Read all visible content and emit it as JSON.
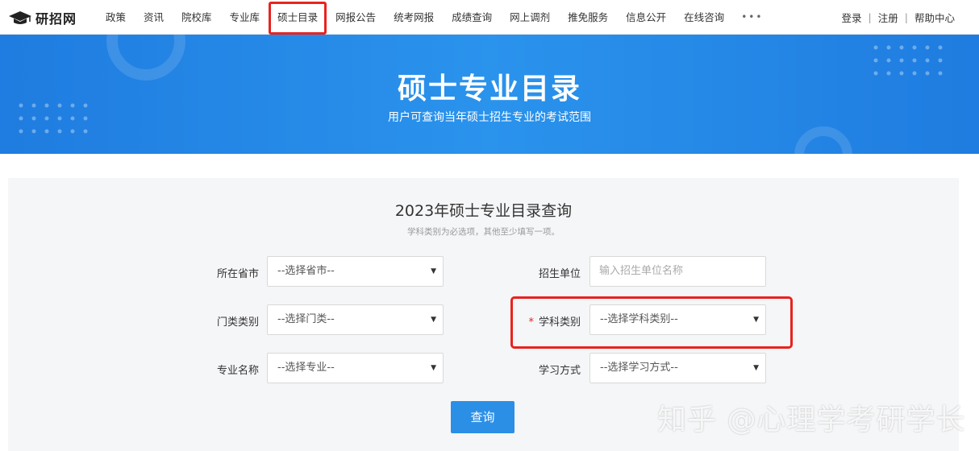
{
  "nav": {
    "logo_text": "研招网",
    "items": [
      "政策",
      "资讯",
      "院校库",
      "专业库",
      "硕士目录",
      "网报公告",
      "统考网报",
      "成绩查询",
      "网上调剂",
      "推免服务",
      "信息公开",
      "在线咨询"
    ],
    "more": "•••",
    "login": "登录",
    "register": "注册",
    "help": "帮助中心",
    "separator": "|"
  },
  "banner": {
    "title": "硕士专业目录",
    "subtitle": "用户可查询当年硕士招生专业的考试范围"
  },
  "panel": {
    "title": "2023年硕士专业目录查询",
    "hint": "学科类别为必选项，其他至少填写一项。",
    "fields": {
      "province": {
        "label": "所在省市",
        "value": "--选择省市--"
      },
      "unit": {
        "label": "招生单位",
        "placeholder": "输入招生单位名称"
      },
      "category": {
        "label": "门类类别",
        "value": "--选择门类--"
      },
      "discipline": {
        "label": "学科类别",
        "value": "--选择学科类别--",
        "required_mark": "*"
      },
      "major": {
        "label": "专业名称",
        "value": "--选择专业--"
      },
      "study_mode": {
        "label": "学习方式",
        "value": "--选择学习方式--"
      }
    },
    "search_button": "查询",
    "arrow": "▼"
  },
  "watermark": "知乎 @心理学考研学长",
  "colors": {
    "brand_blue": "#2b8fe6",
    "highlight_red": "#e8231f",
    "panel_bg": "#f5f6f8"
  }
}
